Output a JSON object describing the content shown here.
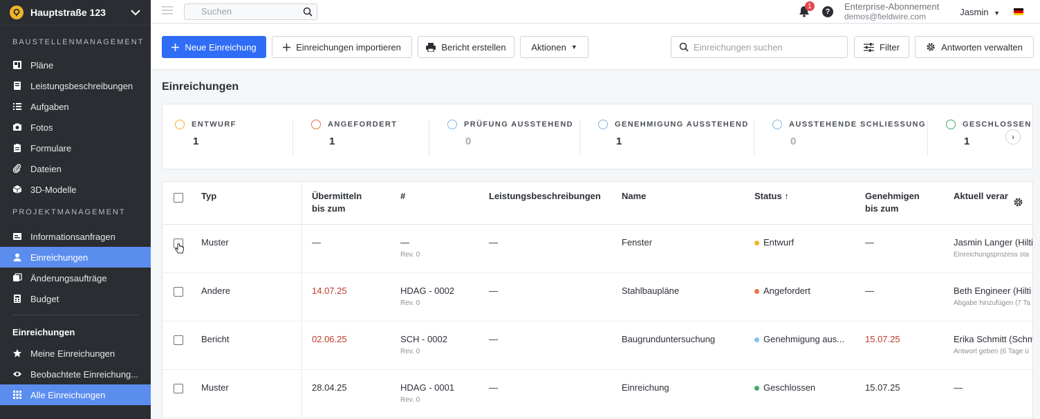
{
  "project": {
    "name": "Hauptstraße 123"
  },
  "sidebar": {
    "section1": "BAUSTELLENMANAGEMENT",
    "items1": [
      {
        "label": "Pläne",
        "icon": "plans-icon"
      },
      {
        "label": "Leistungsbeschreibungen",
        "icon": "book-icon"
      },
      {
        "label": "Aufgaben",
        "icon": "list-icon"
      },
      {
        "label": "Fotos",
        "icon": "camera-icon"
      },
      {
        "label": "Formulare",
        "icon": "clipboard-icon"
      },
      {
        "label": "Dateien",
        "icon": "paperclip-icon"
      },
      {
        "label": "3D-Modelle",
        "icon": "cube-icon"
      }
    ],
    "section2": "PROJEKTMANAGEMENT",
    "items2": [
      {
        "label": "Informationsanfragen",
        "icon": "rfi-icon"
      },
      {
        "label": "Einreichungen",
        "icon": "user-icon"
      },
      {
        "label": "Änderungsaufträge",
        "icon": "change-order-icon"
      },
      {
        "label": "Budget",
        "icon": "calculator-icon"
      }
    ],
    "section3": "Einreichungen",
    "items3": [
      {
        "label": "Meine Einreichungen",
        "icon": "star-icon"
      },
      {
        "label": "Beobachtete Einreichung...",
        "icon": "eye-icon"
      },
      {
        "label": "Alle Einreichungen",
        "icon": "grid-icon"
      }
    ]
  },
  "topbar": {
    "search_placeholder": "Suchen",
    "notification_count": "1",
    "help": "?",
    "plan_line1": "Enterprise-Abonnement",
    "plan_line2": "demos@fieldwire.com",
    "user": "Jasmin"
  },
  "toolbar": {
    "new": "Neue Einreichung",
    "import": "Einreichungen importieren",
    "report": "Bericht erstellen",
    "actions": "Aktionen",
    "search_placeholder": "Einreichungen suchen",
    "filter": "Filter",
    "answers": "Antworten verwalten"
  },
  "page_title": "Einreichungen",
  "stats": [
    {
      "label": "ENTWURF",
      "count": "1",
      "color": "#f0b429"
    },
    {
      "label": "ANGEFORDERT",
      "count": "1",
      "color": "#e8734a"
    },
    {
      "label": "PRÜFUNG AUSSTEHEND",
      "count": "0",
      "color": "#7fb6e8"
    },
    {
      "label": "GENEHMIGUNG AUSSTEHEND",
      "count": "1",
      "color": "#7fb6e8"
    },
    {
      "label": "AUSSTEHENDE SCHLIESSUNG",
      "count": "0",
      "color": "#7fb6e8"
    },
    {
      "label": "GESCHLOSSEN",
      "count": "1",
      "color": "#3dab62"
    }
  ],
  "table": {
    "headers": {
      "typ": "Typ",
      "submit1": "Übermitteln",
      "submit2": "bis zum",
      "num": "#",
      "spec": "Leistungsbeschreibungen",
      "name": "Name",
      "status": "Status ↑",
      "approve1": "Genehmigen",
      "approve2": "bis zum",
      "current": "Aktuell verar"
    },
    "rows": [
      {
        "typ": "Muster",
        "submit": "—",
        "num": "—",
        "rev": "Rev. 0",
        "spec": "—",
        "name": "Fenster",
        "status": "Entwurf",
        "status_color": "#f0b429",
        "approve": "—",
        "current": "Jasmin Langer (Hilti",
        "current_sub": "Einreichungsprozess sta"
      },
      {
        "typ": "Andere",
        "submit": "14.07.25",
        "num": "HDAG - 0002",
        "rev": "Rev. 0",
        "spec": "—",
        "name": "Stahlbaupläne",
        "status": "Angefordert",
        "status_color": "#e8734a",
        "approve": "—",
        "current": "Beth Engineer (Hilti",
        "current_sub": "Abgabe hinzufügen (7 Ta"
      },
      {
        "typ": "Bericht",
        "submit": "02.06.25",
        "num": "SCH - 0002",
        "rev": "Rev. 0",
        "spec": "—",
        "name": "Baugrunduntersuchung",
        "status": "Genehmigung aus...",
        "status_color": "#7fc0ea",
        "approve": "15.07.25",
        "current": "Erika Schmitt (Schm",
        "current_sub": "Antwort geben (6 Tage ü"
      },
      {
        "typ": "Muster",
        "submit": "28.04.25",
        "num": "HDAG - 0001",
        "rev": "Rev. 0",
        "spec": "—",
        "name": "Einreichung",
        "status": "Geschlossen",
        "status_color": "#3dab62",
        "approve": "15.07.25",
        "current": "—",
        "current_sub": ""
      }
    ]
  }
}
